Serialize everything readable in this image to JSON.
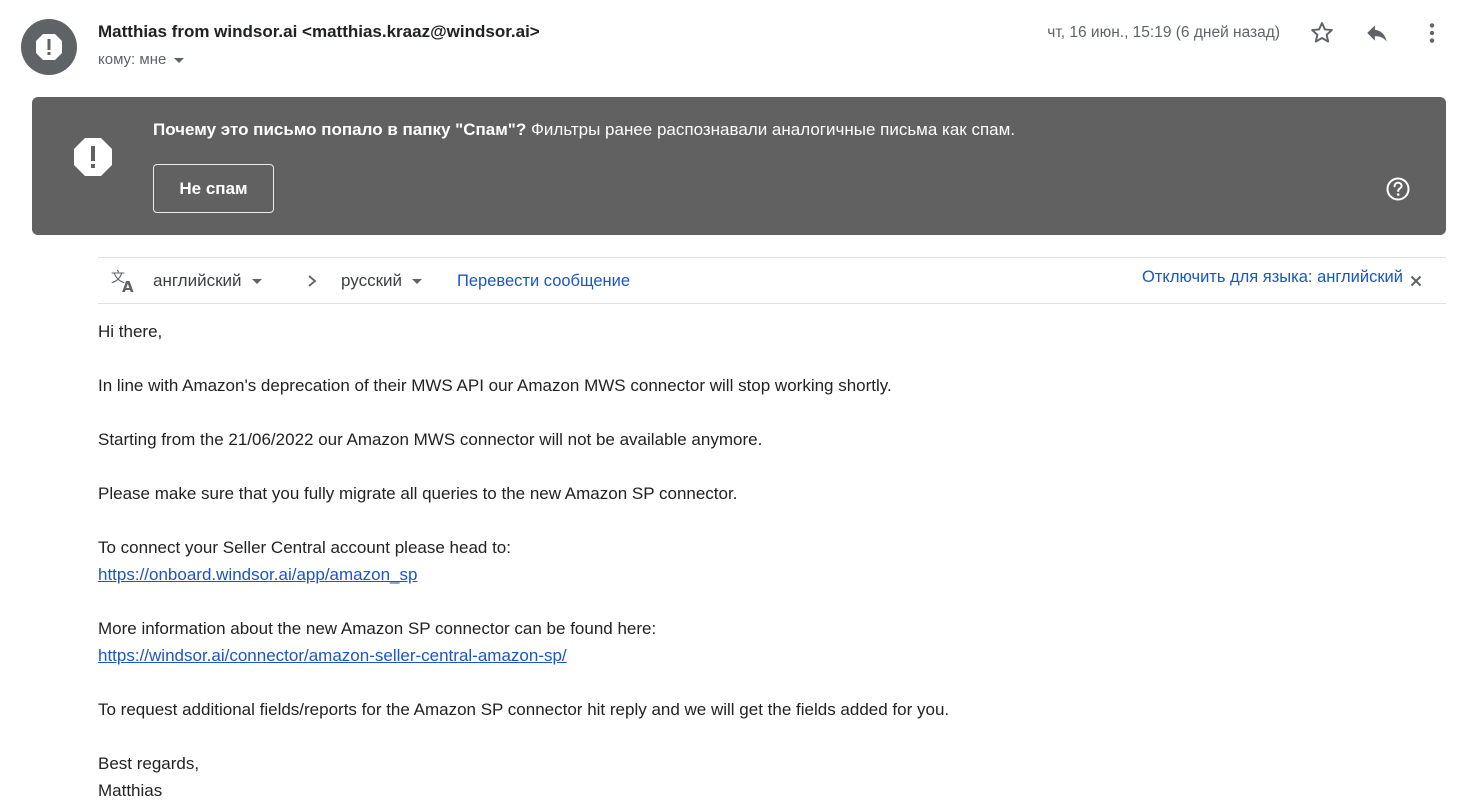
{
  "header": {
    "sender_name": "Matthias from windsor.ai",
    "sender_email": "<matthias.kraaz@windsor.ai>",
    "to_label": "кому: мне",
    "date": "чт, 16 июн., 15:19 (6 дней назад)",
    "icons": [
      "star-icon",
      "reply-icon",
      "more-vert-icon"
    ]
  },
  "spam_banner": {
    "question": "Почему это письмо попало в папку \"Спам\"?",
    "explanation": " Фильтры ранее распознавали аналогичные письма как спам.",
    "not_spam_button": "Не спам",
    "background": "#616161"
  },
  "translate": {
    "from_lang": "английский",
    "to_lang": "русский",
    "translate_link": "Перевести сообщение",
    "disable_link": "Отключить для языка: английский"
  },
  "message": {
    "greeting": "Hi there,",
    "p1": "In line with Amazon's deprecation of their MWS API our Amazon MWS connector will stop working shortly.",
    "p2": "Starting from the 21/06/2022 our Amazon MWS connector will not be available anymore.",
    "p3": "Please make sure that you fully migrate all queries to the new Amazon SP connector.",
    "p4": "To connect your Seller Central account please head to:",
    "link1": "https://onboard.windsor.ai/app/amazon_sp",
    "p5": "More information about the new Amazon SP connector can be found here:",
    "link2": "https://windsor.ai/connector/amazon-seller-central-amazon-sp/",
    "p6": "To request additional fields/reports for the Amazon SP connector hit reply and we will get the fields added for you.",
    "signoff": "Best regards,",
    "signature": "Matthias"
  },
  "colors": {
    "link": "#1a56c4",
    "muted": "#5f6368"
  }
}
